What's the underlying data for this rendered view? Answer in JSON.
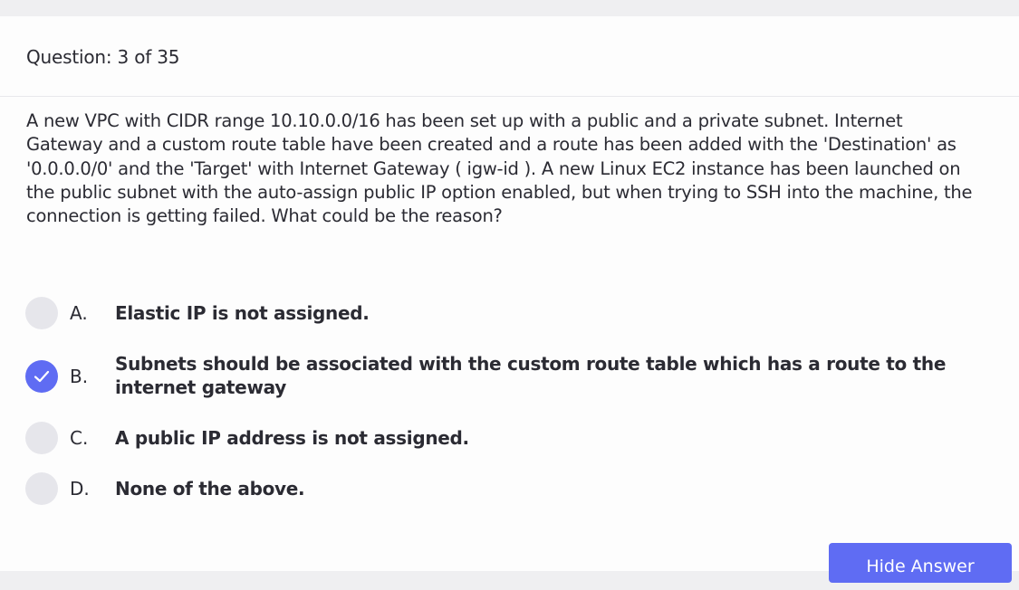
{
  "question": {
    "counter": "Question: 3 of 35",
    "text": "A new VPC with CIDR range 10.10.0.0/16 has been set up with a public and a private subnet. Internet Gateway and a custom route table have been created and a route has been added with the 'Destination' as '0.0.0.0/0' and the 'Target' with Internet Gateway ( igw-id ). A new Linux EC2 instance has been launched on the public subnet with the auto-assign public IP option enabled, but when trying to SSH into the machine, the connection is getting failed. What could be the reason?"
  },
  "options": [
    {
      "letter": "A.",
      "text": "Elastic IP is not assigned.",
      "selected": false
    },
    {
      "letter": "B.",
      "text": "Subnets should be associated with the custom route table which has a route to the internet gateway",
      "selected": true
    },
    {
      "letter": "C.",
      "text": "A public IP address is not assigned.",
      "selected": false
    },
    {
      "letter": "D.",
      "text": "None of the above.",
      "selected": false
    }
  ],
  "actions": {
    "hide_answer_label": "Hide Answer"
  },
  "colors": {
    "accent": "#5f6cf3",
    "radio_unselected": "#e6e6eb"
  },
  "icons": {
    "selected_marker": "checkmark-icon"
  }
}
